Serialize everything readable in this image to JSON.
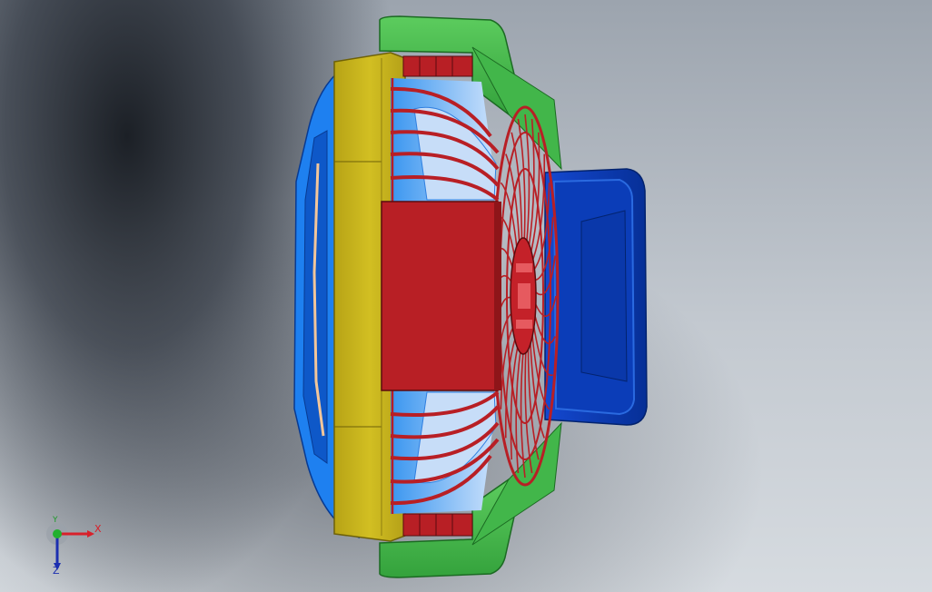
{
  "viewport": {
    "background_top": "#9ca4ae",
    "background_bottom": "#d6dbe0"
  },
  "model": {
    "parts": [
      {
        "name": "rear-clip-plate",
        "color": "#1e80f0"
      },
      {
        "name": "yellow-ring",
        "color": "#c6b31c"
      },
      {
        "name": "green-stand",
        "color": "#3fb548"
      },
      {
        "name": "red-motor-housing",
        "color": "#b81f25"
      },
      {
        "name": "red-grille",
        "color": "#b81f25"
      },
      {
        "name": "blue-blades",
        "color": "#3e9ff2"
      },
      {
        "name": "blue-knob",
        "color": "#0636a8"
      }
    ]
  },
  "triad": {
    "x_label": "X",
    "y_label": "Y",
    "z_label": "Z",
    "x_color": "#d8202a",
    "y_color": "#1e9a2a",
    "z_color": "#1c2fb0"
  }
}
